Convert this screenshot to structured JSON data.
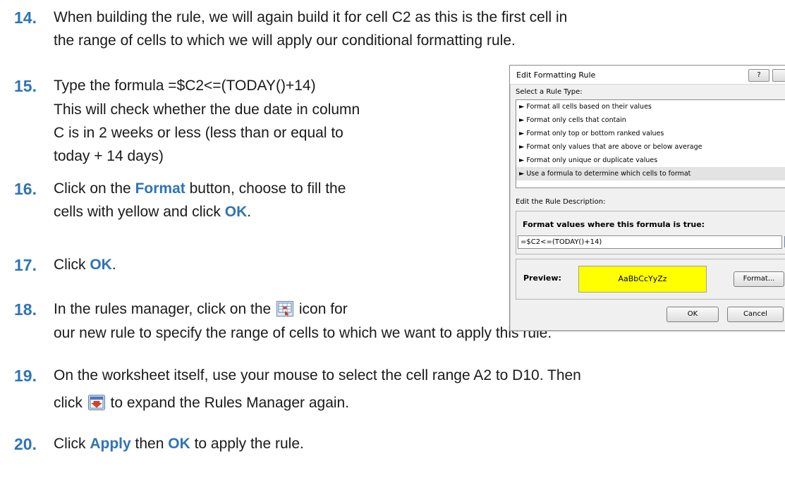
{
  "steps": [
    {
      "number": "14.",
      "line1": "When building the rule, we will again build it for cell C2 as this is the first cell in",
      "line2": "the range of cells to which we will apply our conditional formatting rule."
    },
    {
      "number": "15.",
      "line1": "Type the formula =$C2<=(TODAY()+14)",
      "line2": "This will check whether the due date in column",
      "line3": "C is in 2 weeks or less (less than or equal to",
      "line4": "today + 14 days)"
    },
    {
      "number": "16.",
      "line1_pre": "Click on the ",
      "line1_kw": "Format",
      "line1_post": " button, choose to fill the",
      "line2_pre": "cells with yellow and click ",
      "line2_kw": "OK",
      "line2_post": "."
    },
    {
      "number": "17.",
      "pre": "Click ",
      "kw": "OK",
      "post": "."
    },
    {
      "number": "18.",
      "line1_pre": "In the rules manager, click on the ",
      "line1_post": " icon for",
      "line2": "our new rule to specify the range of cells to which we want to apply this rule."
    },
    {
      "number": "19.",
      "line1": "On the worksheet itself, use your mouse to select the cell range A2 to D10. Then",
      "line2_pre": "click ",
      "line2_post": " to expand the Rules Manager again."
    },
    {
      "number": "20.",
      "pre": "Click ",
      "kw1": "Apply",
      "mid": " then ",
      "kw2": "OK",
      "post": " to apply the rule."
    }
  ],
  "dialog": {
    "title": "Edit Formatting Rule",
    "help_label": "?",
    "rule_type_label": "Select a Rule Type:",
    "rule_types": [
      "► Format all cells based on their values",
      "► Format only cells that contain",
      "► Format only top or bottom ranked values",
      "► Format only values that are above or below average",
      "► Format only unique or duplicate values",
      "► Use a formula to determine which cells to format"
    ],
    "selected_index": 5,
    "description_label": "Edit the Rule Description:",
    "formula_heading": "Format values where this formula is true:",
    "formula_value": "=$C2<=(TODAY()+14)",
    "preview_label": "Preview:",
    "preview_text": "AaBbCcYyZz",
    "preview_fill": "#ffff00",
    "format_button": "Format...",
    "ok_button": "OK",
    "cancel_button": "Cancel"
  },
  "colors": {
    "accent": "#2e74b5"
  }
}
